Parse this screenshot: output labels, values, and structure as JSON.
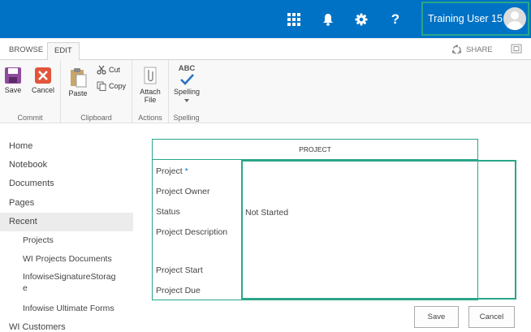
{
  "suitebar": {
    "bg": "#0072c6",
    "icons": [
      "app-launcher-icon",
      "bell-icon",
      "gear-icon",
      "help-icon"
    ],
    "help_glyph": "?",
    "user_name": "Training User 15",
    "highlight_color": "#2aa68a"
  },
  "ribbon": {
    "tabs": [
      {
        "label": "BROWSE",
        "active": false
      },
      {
        "label": "EDIT",
        "active": true
      }
    ],
    "share_label": "SHARE",
    "groups": {
      "commit": {
        "label": "Commit",
        "save": "Save",
        "cancel": "Cancel"
      },
      "clipboard": {
        "label": "Clipboard",
        "paste": "Paste",
        "cut": "Cut",
        "copy": "Copy"
      },
      "actions": {
        "label": "Actions",
        "attach_line1": "Attach",
        "attach_line2": "File"
      },
      "spelling": {
        "label": "Spelling",
        "abc": "ABC",
        "spelling": "Spelling"
      }
    }
  },
  "nav": {
    "items": [
      {
        "label": "Home"
      },
      {
        "label": "Notebook"
      },
      {
        "label": "Documents"
      },
      {
        "label": "Pages"
      },
      {
        "label": "Recent",
        "selected": true
      },
      {
        "label": "Projects",
        "sub": true
      },
      {
        "label": "WI Projects Documents",
        "sub": true
      },
      {
        "label": "InfowiseSignatureStorag",
        "label2": "e",
        "sub": true
      },
      {
        "label": "Infowise Ultimate Forms",
        "sub": true
      },
      {
        "label": "WI Customers"
      }
    ]
  },
  "form": {
    "header": "PROJECT",
    "fields": [
      {
        "label": "Project",
        "required_mark": "*",
        "value": ""
      },
      {
        "label": "Project Owner",
        "value": ""
      },
      {
        "label": "Status",
        "value": "Not Started"
      },
      {
        "label": "Project Description",
        "value": ""
      },
      {
        "label": "Project Start",
        "value": ""
      },
      {
        "label": "Project Due",
        "value": ""
      }
    ],
    "save_label": "Save",
    "cancel_label": "Cancel"
  }
}
